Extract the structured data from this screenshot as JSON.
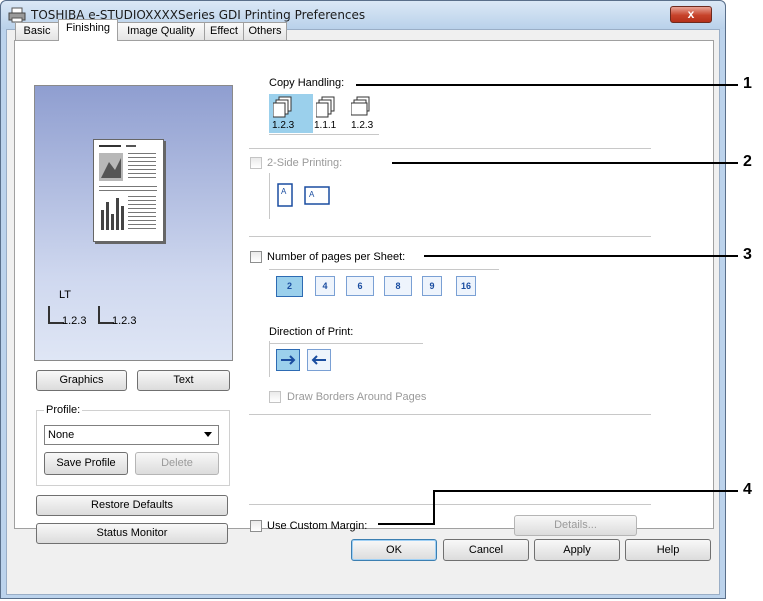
{
  "window": {
    "title": "TOSHIBA e-STUDIOXXXXSeries GDI Printing Preferences",
    "close_glyph": "x"
  },
  "tabs": [
    "Basic",
    "Finishing",
    "Image Quality",
    "Effect",
    "Others"
  ],
  "active_tab": "Finishing",
  "preview": {
    "paper_label": "LT",
    "copy_labels": [
      "1.2.3",
      "1.2.3"
    ]
  },
  "left_buttons": {
    "graphics": "Graphics",
    "text": "Text"
  },
  "profile": {
    "label": "Profile:",
    "value": "None",
    "save": "Save Profile",
    "delete": "Delete"
  },
  "bottom_left_buttons": {
    "restore": "Restore Defaults",
    "status": "Status Monitor"
  },
  "copy_handling": {
    "label": "Copy Handling:",
    "options": [
      "1.2.3",
      "1.1.1",
      "1.2.3"
    ],
    "selected_index": 0
  },
  "two_side": {
    "label": "2-Side Printing:",
    "enabled": false
  },
  "pages_per_sheet": {
    "label": "Number of pages per Sheet:",
    "options": [
      "2",
      "4",
      "6",
      "8",
      "9",
      "16"
    ],
    "selected_index": 0
  },
  "direction": {
    "label": "Direction of Print:",
    "options": [
      "right-arrow-icon",
      "left-arrow-icon"
    ],
    "selected_index": 0
  },
  "draw_borders": {
    "label": "Draw Borders Around Pages",
    "enabled": false
  },
  "custom_margin": {
    "label": "Use Custom Margin:",
    "details": "Details..."
  },
  "dialog_buttons": {
    "ok": "OK",
    "cancel": "Cancel",
    "apply": "Apply",
    "help": "Help"
  },
  "callouts": [
    "1",
    "2",
    "3",
    "4"
  ]
}
